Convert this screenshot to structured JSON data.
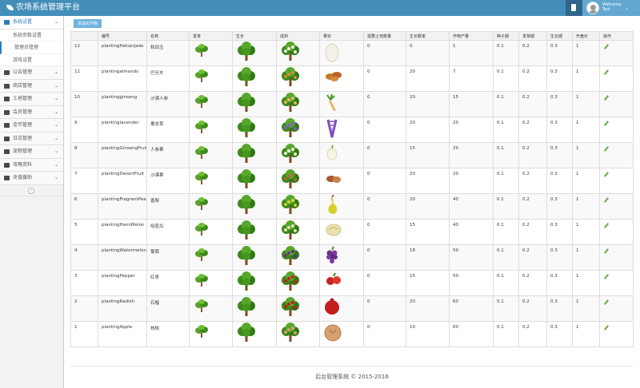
{
  "header": {
    "title": "农场系统管理平台",
    "welcome": "Welcome,",
    "username": "Test"
  },
  "sidebar": {
    "items": [
      {
        "label": "系统设置",
        "open": true,
        "icon": "gear-icon"
      },
      {
        "label": "公告管理",
        "icon": "bullhorn-icon"
      },
      {
        "label": "商店管理",
        "icon": "cart-icon"
      },
      {
        "label": "土地管理",
        "icon": "globe-icon"
      },
      {
        "label": "会员管理",
        "icon": "users-icon"
      },
      {
        "label": "金币管理",
        "icon": "exchange-icon"
      },
      {
        "label": "日志管理",
        "icon": "calendar-icon"
      },
      {
        "label": "宠物管理",
        "icon": "heart-icon"
      },
      {
        "label": "攻略资料",
        "icon": "folder-icon"
      },
      {
        "label": "充值援助",
        "icon": "list-icon"
      }
    ],
    "subitems": [
      "系统参数设置",
      "管理员管理",
      "游戏设置"
    ]
  },
  "toolbar": {
    "add_label": "添加农作物"
  },
  "table": {
    "headers": [
      "",
      "编号",
      "名称",
      "发芽",
      "生长",
      "成熟",
      "果实",
      "需要土地数量",
      "生长概率",
      "作物产量",
      "种子期",
      "发芽期",
      "生长期",
      "开盘价",
      "操作"
    ],
    "rows": [
      {
        "id": "12",
        "code": "plantingHetianJade",
        "name": "和田玉",
        "need": "0",
        "prob": "0",
        "yield": "1",
        "seed": "0.1",
        "sprout": "0.2",
        "grow": "0.3",
        "price": "1",
        "fruit": "jade"
      },
      {
        "id": "11",
        "code": "plantingalmonds",
        "name": "巴旦木",
        "need": "0",
        "prob": "20",
        "yield": "7",
        "seed": "0.1",
        "sprout": "0.2",
        "grow": "0.3",
        "price": "1",
        "fruit": "almond"
      },
      {
        "id": "10",
        "code": "plantingginseng",
        "name": "沙漠人参",
        "need": "0",
        "prob": "20",
        "yield": "15",
        "seed": "0.1",
        "sprout": "0.2",
        "grow": "0.3",
        "price": "1",
        "fruit": "ginseng"
      },
      {
        "id": "9",
        "code": "plantinglavender",
        "name": "薰衣草",
        "need": "0",
        "prob": "20",
        "yield": "20",
        "seed": "0.1",
        "sprout": "0.2",
        "grow": "0.3",
        "price": "1",
        "fruit": "lavender"
      },
      {
        "id": "8",
        "code": "plantingGinsengFruit",
        "name": "人参果",
        "need": "0",
        "prob": "15",
        "yield": "20",
        "seed": "0.1",
        "sprout": "0.2",
        "grow": "0.3",
        "price": "1",
        "fruit": "ginsengfruit"
      },
      {
        "id": "7",
        "code": "plantingDesertFruit",
        "name": "沙漠果",
        "need": "0",
        "prob": "20",
        "yield": "20",
        "seed": "0.1",
        "sprout": "0.2",
        "grow": "0.3",
        "price": "1",
        "fruit": "desertfruit"
      },
      {
        "id": "6",
        "code": "plantingFragrantPea",
        "name": "香梨",
        "need": "0",
        "prob": "20",
        "yield": "40",
        "seed": "0.1",
        "sprout": "0.2",
        "grow": "0.3",
        "price": "1",
        "fruit": "pear"
      },
      {
        "id": "5",
        "code": "plantingHamiMelon",
        "name": "哈密瓜",
        "need": "0",
        "prob": "15",
        "yield": "40",
        "seed": "0.1",
        "sprout": "0.2",
        "grow": "0.3",
        "price": "1",
        "fruit": "melon"
      },
      {
        "id": "4",
        "code": "plantingWatermelon",
        "name": "葡萄",
        "need": "0",
        "prob": "18",
        "yield": "50",
        "seed": "0.1",
        "sprout": "0.2",
        "grow": "0.3",
        "price": "1",
        "fruit": "grape"
      },
      {
        "id": "3",
        "code": "plantingPepper",
        "name": "红枣",
        "need": "0",
        "prob": "15",
        "yield": "50",
        "seed": "0.1",
        "sprout": "0.2",
        "grow": "0.3",
        "price": "1",
        "fruit": "jujube"
      },
      {
        "id": "2",
        "code": "plantingRadish",
        "name": "石榴",
        "need": "0",
        "prob": "20",
        "yield": "60",
        "seed": "0.1",
        "sprout": "0.2",
        "grow": "0.3",
        "price": "1",
        "fruit": "pomegranate"
      },
      {
        "id": "1",
        "code": "plantingApple",
        "name": "核桃",
        "need": "0",
        "prob": "10",
        "yield": "60",
        "seed": "0.1",
        "sprout": "0.2",
        "grow": "0.3",
        "price": "1",
        "fruit": "walnut"
      }
    ]
  },
  "footer": {
    "text": "后台管理系统 © 2015-2016"
  },
  "colors": {
    "header": "#438eb9",
    "accent": "#2b7dbc",
    "edit": "#69aa46"
  }
}
